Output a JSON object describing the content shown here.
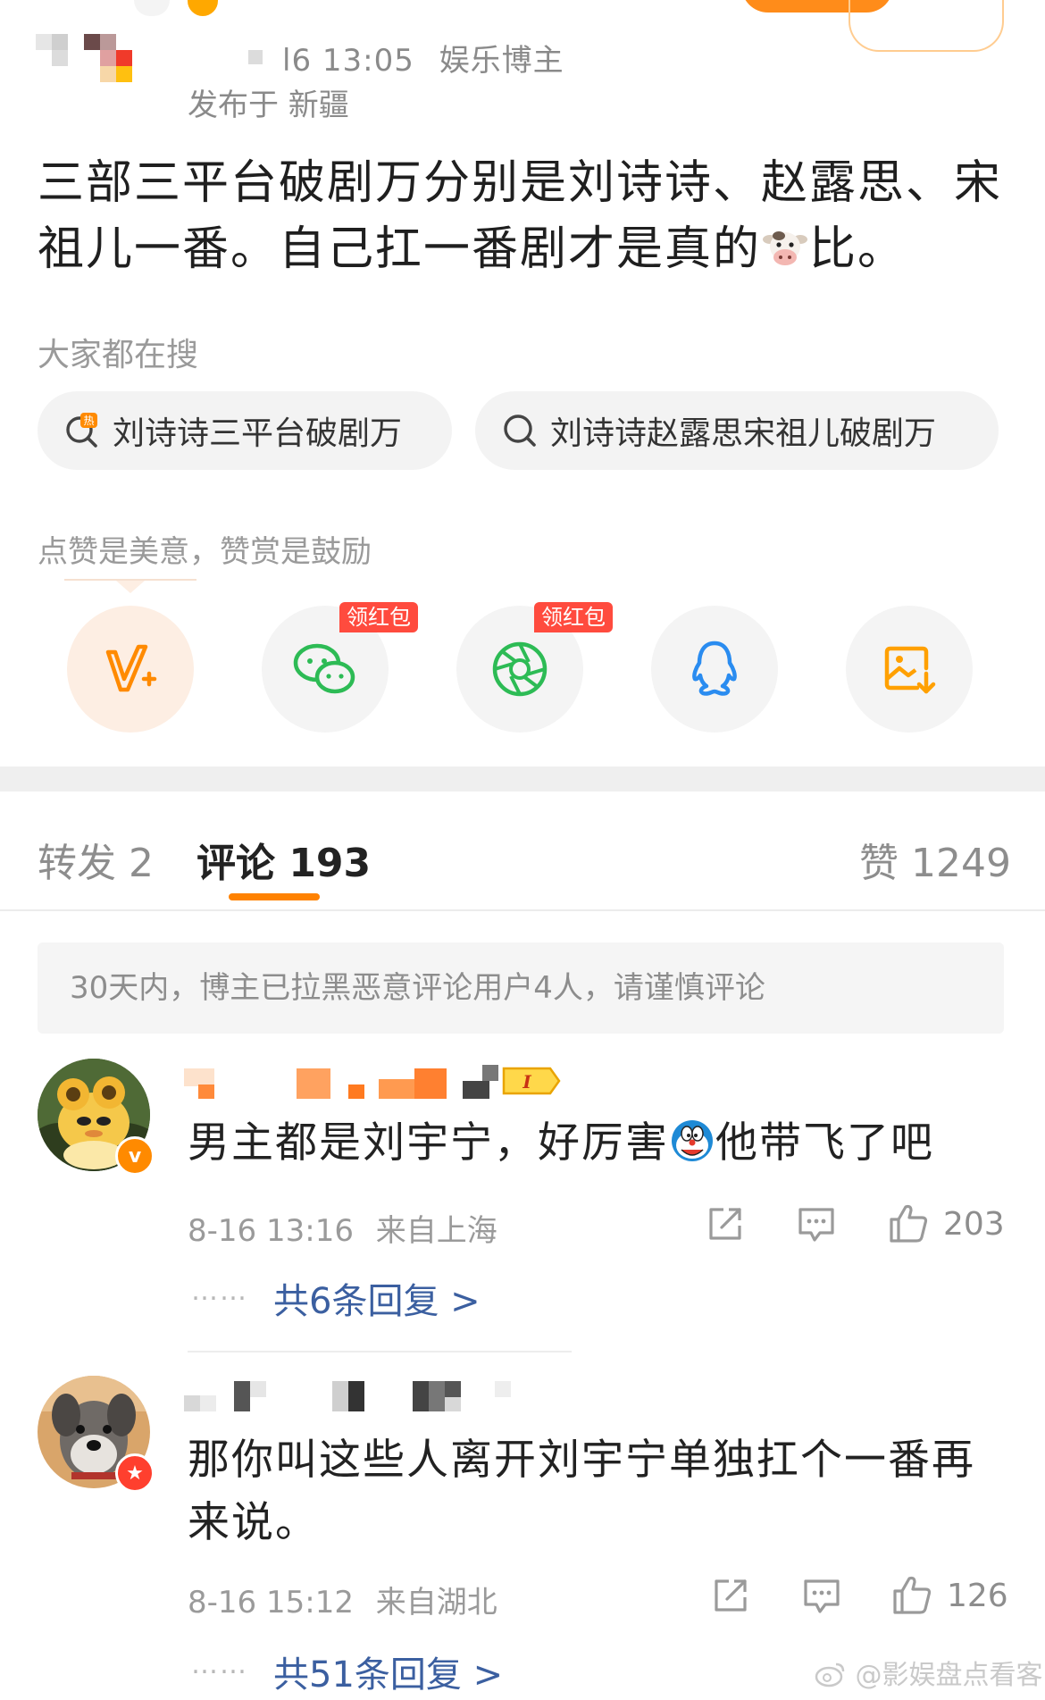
{
  "post": {
    "time_text": "l6 13:05",
    "author_type": "娱乐博主",
    "location": "发布于 新疆",
    "text_before_emoji": "三部三平台破剧万分别是刘诗诗、赵露思、宋祖儿一番。自己扛一番剧才是真的",
    "emoji": "cow-face",
    "text_after_emoji": "比。"
  },
  "search": {
    "label": "大家都在搜",
    "chips": [
      {
        "text": "刘诗诗三平台破剧万",
        "icon": "hot-search-icon"
      },
      {
        "text": "刘诗诗赵露思宋祖儿破剧万",
        "icon": "search-icon"
      }
    ]
  },
  "reward": {
    "label": "点赞是美意，赞赏是鼓励",
    "share_targets": [
      {
        "icon": "weibo-vplus-icon",
        "badge": ""
      },
      {
        "icon": "wechat-icon",
        "badge": "领红包"
      },
      {
        "icon": "moments-icon",
        "badge": "领红包"
      },
      {
        "icon": "qq-icon",
        "badge": ""
      },
      {
        "icon": "save-image-icon",
        "badge": ""
      }
    ]
  },
  "tabs": {
    "repost": "转发 2",
    "comments": "评论 193",
    "likes": "赞 1249"
  },
  "notice": "30天内，博主已拉黑恶意评论用户4人，请谨慎评论",
  "comments": [
    {
      "text_before_emoji": "男主都是刘宇宁，好厉害",
      "emoji": "doraemon",
      "text_after_emoji": "他带飞了吧",
      "time": "8-16 13:16",
      "location": "来自上海",
      "likes": "203",
      "replies_dots": "……",
      "replies": "共6条回复 >",
      "level_badge": "I"
    },
    {
      "text": "那你叫这些人离开刘宇宁单独扛个一番再来说。",
      "time": "8-16 15:12",
      "location": "来自湖北",
      "likes": "126",
      "replies_dots": "……",
      "replies": "共51条回复 >"
    }
  ],
  "watermark": "@影娱盘点看客",
  "colors": {
    "accent": "#ff8200",
    "link": "#3b5fa0",
    "badge_red": "#ff4b3e",
    "muted": "#9a9a9a"
  }
}
